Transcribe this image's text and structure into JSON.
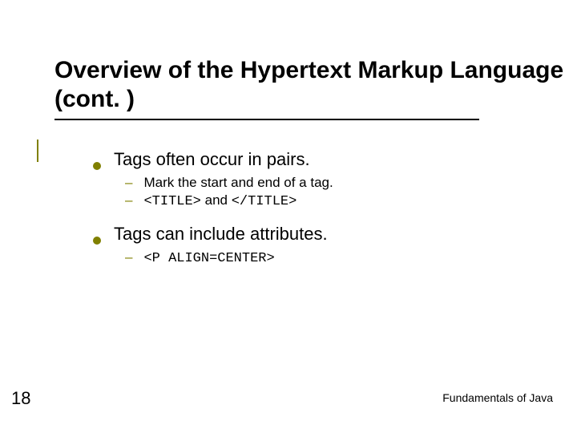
{
  "title": "Overview of the Hypertext Markup Language (cont. )",
  "items": [
    {
      "text": "Tags often occur in pairs.",
      "subs": [
        {
          "text": "Mark the start and end of a tag.",
          "mono": false
        },
        {
          "text": "<TITLE> and </TITLE>",
          "mono": true,
          "mixed": true,
          "parts": [
            {
              "t": "<TITLE>",
              "m": true
            },
            {
              "t": " and ",
              "m": false
            },
            {
              "t": "</TITLE>",
              "m": true
            }
          ]
        }
      ]
    },
    {
      "text": "Tags can include attributes.",
      "subs": [
        {
          "text": "<P ALIGN=CENTER>",
          "mono": true
        }
      ]
    }
  ],
  "pageNumber": "18",
  "footer": "Fundamentals of Java"
}
